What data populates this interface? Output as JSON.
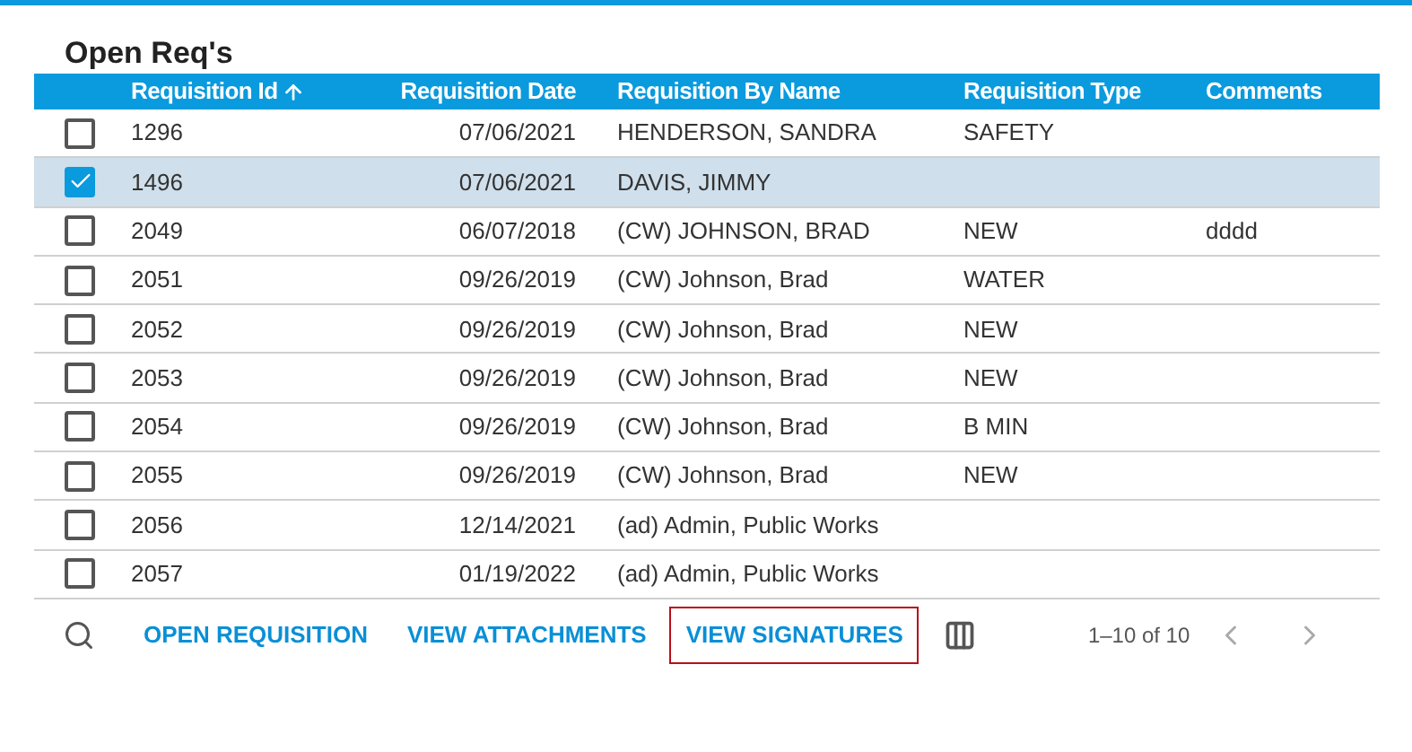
{
  "title": "Open Req's",
  "table": {
    "columns": [
      {
        "label": "Requisition Id",
        "sorted": true
      },
      {
        "label": "Requisition Date",
        "sorted": false
      },
      {
        "label": "Requisition By Name",
        "sorted": false
      },
      {
        "label": "Requisition Type",
        "sorted": false
      },
      {
        "label": "Comments",
        "sorted": false
      }
    ],
    "rows": [
      {
        "selected": false,
        "cells": [
          "1296",
          "07/06/2021",
          "HENDERSON, SANDRA",
          "SAFETY",
          ""
        ]
      },
      {
        "selected": true,
        "cells": [
          "1496",
          "07/06/2021",
          "DAVIS, JIMMY",
          "",
          ""
        ]
      },
      {
        "selected": false,
        "cells": [
          "2049",
          "06/07/2018",
          "(CW) JOHNSON, BRAD",
          "NEW",
          "dddd"
        ]
      },
      {
        "selected": false,
        "cells": [
          "2051",
          "09/26/2019",
          "(CW) Johnson, Brad",
          "WATER",
          ""
        ]
      },
      {
        "selected": false,
        "cells": [
          "2052",
          "09/26/2019",
          "(CW) Johnson, Brad",
          "NEW",
          ""
        ]
      },
      {
        "selected": false,
        "cells": [
          "2053",
          "09/26/2019",
          "(CW) Johnson, Brad",
          "NEW",
          ""
        ]
      },
      {
        "selected": false,
        "cells": [
          "2054",
          "09/26/2019",
          "(CW) Johnson, Brad",
          "B MIN",
          ""
        ]
      },
      {
        "selected": false,
        "cells": [
          "2055",
          "09/26/2019",
          "(CW) Johnson, Brad",
          "NEW",
          ""
        ]
      },
      {
        "selected": false,
        "cells": [
          "2056",
          "12/14/2021",
          "(ad) Admin, Public Works",
          "",
          ""
        ]
      },
      {
        "selected": false,
        "cells": [
          "2057",
          "01/19/2022",
          "(ad) Admin, Public Works",
          "",
          ""
        ]
      }
    ]
  },
  "toolbar": {
    "buttons": [
      {
        "label": "OPEN REQUISITION",
        "focused": false
      },
      {
        "label": "VIEW ATTACHMENTS",
        "focused": false
      },
      {
        "label": "VIEW SIGNATURES",
        "focused": true
      }
    ],
    "pagination": "1–10 of 10"
  }
}
